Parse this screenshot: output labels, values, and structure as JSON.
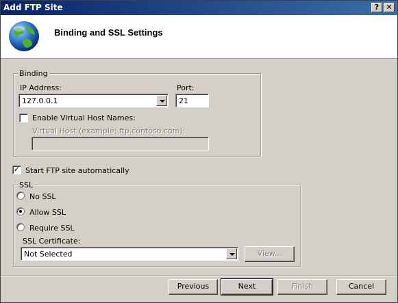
{
  "window": {
    "title": "Add FTP Site"
  },
  "header": {
    "title": "Binding and SSL Settings"
  },
  "binding": {
    "legend": "Binding",
    "ip_label": "IP Address:",
    "ip_value": "127.0.0.1",
    "port_label": "Port:",
    "port_value": "21",
    "virtual_host_check_label": "Enable Virtual Host Names:",
    "virtual_host_label": "Virtual Host (example: ftp.contoso.com):",
    "virtual_host_value": ""
  },
  "start_auto": {
    "label": "Start FTP site automatically",
    "checked": true
  },
  "ssl": {
    "legend": "SSL",
    "options": [
      "No SSL",
      "Allow SSL",
      "Require SSL"
    ],
    "selected": "Allow SSL",
    "cert_label": "SSL Certificate:",
    "cert_value": "Not Selected",
    "view_label": "View..."
  },
  "footer": {
    "previous": "Previous",
    "next": "Next",
    "finish": "Finish",
    "cancel": "Cancel"
  }
}
